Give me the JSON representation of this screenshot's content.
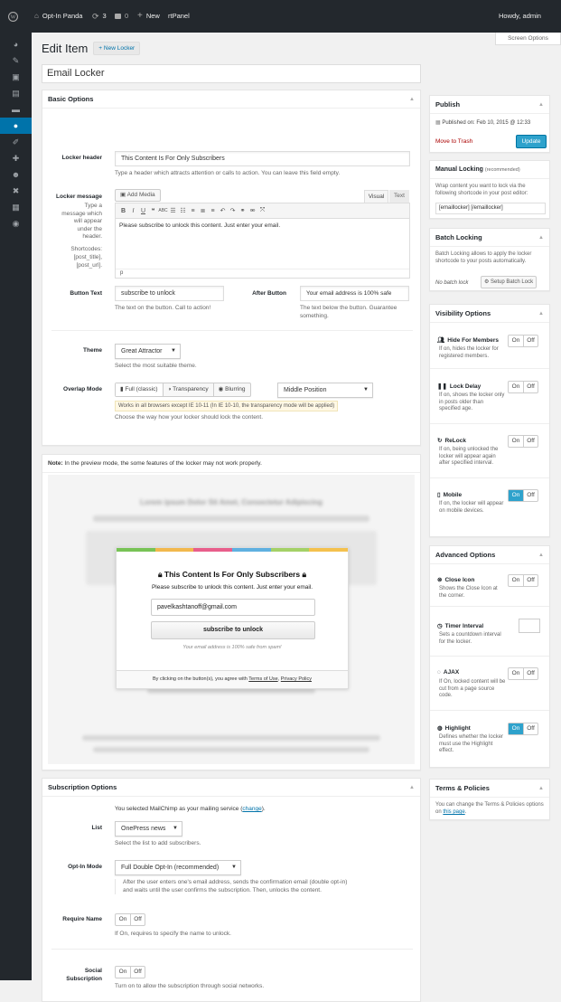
{
  "adminbar": {
    "site": "Opt-In Panda",
    "updates": "3",
    "comments": "0",
    "new": "New",
    "rtpanel": "rtPanel",
    "howdy": "Howdy, admin"
  },
  "screen_options": "Screen Options",
  "heading": {
    "title": "Edit Item",
    "add_new": "+ New Locker"
  },
  "item_title": "Email Locker",
  "basic": {
    "title": "Basic Options",
    "locker_header_label": "Locker header",
    "locker_header_value": "This Content Is For Only Subscribers",
    "locker_header_desc": "Type a header which attracts attention or calls to action. You can leave this field empty.",
    "locker_message_label": "Locker message",
    "locker_message_desc": "Type a message which will appear under the header.",
    "shortcodes_label": "Shortcodes:",
    "shortcode1": "[post_title],",
    "shortcode2": "[post_url].",
    "add_media": "Add Media",
    "tab_visual": "Visual",
    "tab_text": "Text",
    "message_value": "Please subscribe to unlock this content. Just enter your email.",
    "editor_path": "p",
    "button_text_label": "Button Text",
    "button_text_value": "subscribe to unlock",
    "button_text_desc": "The text on the button. Call to action!",
    "after_button_label": "After Button",
    "after_button_value": "Your email address is 100% safe",
    "after_button_desc": "The text below the button. Guarantee something.",
    "theme_label": "Theme",
    "theme_value": "Great Attractor",
    "theme_desc": "Select the most suitable theme.",
    "overlap_label": "Overlap Mode",
    "overlap_modes": [
      "Full (classic)",
      "Transparency",
      "Blurring"
    ],
    "overlap_position": "Middle Position",
    "overlap_warning": "Works in all browsers except IE 10-11 (In IE 10-10, the transparency mode will be applied)",
    "overlap_desc": "Choose the way how your locker should lock the content."
  },
  "preview": {
    "note_bold": "Note:",
    "note": " In the preview mode, the some features of the locker may not work properly.",
    "blur_title": "Lorem ipsum Dolor Sit Amet, Consectetur Adipiscing",
    "locker_header": "This Content Is For Only Subscribers",
    "locker_message": "Please subscribe to unlock this content. Just enter your email.",
    "email": "pavelkashtanoff@gmail.com",
    "button": "subscribe to unlock",
    "after": "Your email address is 100% safe from spam!",
    "terms_pre": "By clicking on the button(s), you agree with ",
    "terms_link": "Terms of Use",
    "terms_mid": ", ",
    "privacy_link": "Privacy Policy"
  },
  "subscription": {
    "title": "Subscription Options",
    "service_pre": "You selected MailChimp as your mailing service (",
    "service_link": "change",
    "service_post": ").",
    "list_label": "List",
    "list_value": "OnePress news",
    "list_desc": "Select the list to add subscribers.",
    "optin_label": "Opt-In Mode",
    "optin_value": "Full Double Opt-In (recommended)",
    "optin_desc": "After the user enters one's email address, sends the confirmation email (double opt-in) and waits until the user confirms the subscription. Then, unlocks the content.",
    "require_name_label": "Require Name",
    "require_name_desc": "If On, requires to specify the name to unlock.",
    "social_label1": "Social",
    "social_label2": "Subscription",
    "social_desc": "Turn on to allow the subscription through social networks."
  },
  "onoff": {
    "on": "On",
    "off": "Off"
  },
  "publish": {
    "title": "Publish",
    "published": "Published on: Feb 10, 2015 @ 12:33",
    "trash": "Move to Trash",
    "update": "Update"
  },
  "manual": {
    "title": "Manual Locking",
    "recommended": "(recommended)",
    "desc": "Wrap content you want to lock via the following shortcode in your post editor:",
    "shortcode": "[emaillocker] [/emaillocker]"
  },
  "batch": {
    "title": "Batch Locking",
    "desc": "Batch Locking allows to apply the locker shortcode to your posts automatically.",
    "none": "No batch lock",
    "setup": "Setup Batch Lock"
  },
  "visibility": {
    "title": "Visibility Options",
    "items": [
      {
        "label": "Hide For Members",
        "desc": "If on, hides the locker for registered members."
      },
      {
        "label": "Lock Delay",
        "desc": "If on, shows the locker only in posts older than specified age."
      },
      {
        "label": "ReLock",
        "desc": "If on, being unlocked the locker will appear again after specified interval."
      },
      {
        "label": "Mobile",
        "desc": "If on, the locker will appear on mobile devices."
      }
    ]
  },
  "advanced": {
    "title": "Advanced Options",
    "items": [
      {
        "label": "Close Icon",
        "desc": "Shows the Close Icon at the corner."
      },
      {
        "label": "Timer Interval",
        "desc": "Sets a countdown interval for the locker."
      },
      {
        "label": "AJAX",
        "desc": "If On, locked content will be cut from a page source code."
      },
      {
        "label": "Highlight",
        "desc": "Defines whether the locker must use the Highlight effect."
      }
    ]
  },
  "terms": {
    "title": "Terms & Policies",
    "desc_pre": "You can change the Terms & Policies options on ",
    "link": "this page",
    "desc_post": "."
  },
  "colors": {
    "accent": "#0073aa",
    "toggle_on": "#2ea2cc",
    "adminbar": "#23282d",
    "trash": "#a00",
    "warning_bg": "#fff8e5"
  }
}
